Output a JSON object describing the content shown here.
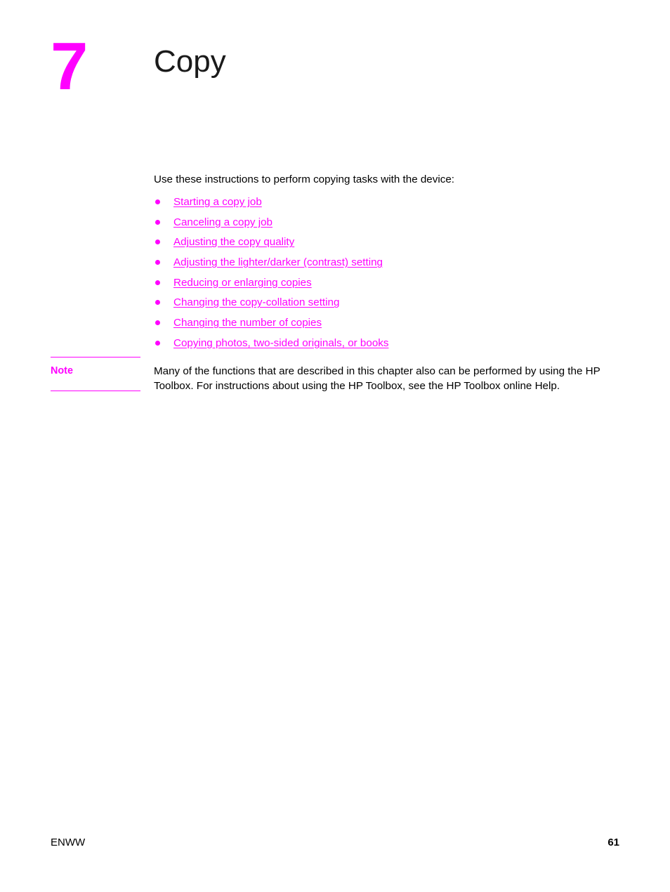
{
  "chapter": {
    "number": "7",
    "title": "Copy",
    "number_color": "#ff00ff",
    "title_color": "#1a1a1a"
  },
  "intro": {
    "text": "Use these instructions to perform copying tasks with the device:"
  },
  "toc": {
    "bullet_color": "#ff00ff",
    "link_color": "#ff00ff",
    "items": [
      {
        "label": "Starting a copy job"
      },
      {
        "label": "Canceling a copy job"
      },
      {
        "label": "Adjusting the copy quality"
      },
      {
        "label": "Adjusting the lighter/darker (contrast) setting"
      },
      {
        "label": "Reducing or enlarging copies"
      },
      {
        "label": "Changing the copy-collation setting"
      },
      {
        "label": "Changing the number of copies"
      },
      {
        "label": "Copying photos, two-sided originals, or books"
      }
    ]
  },
  "note": {
    "label": "Note",
    "label_color": "#ff00ff",
    "rule_color": "#ff00ff",
    "body": "Many of the functions that are described in this chapter also can be performed by using the HP Toolbox. For instructions about using the HP Toolbox, see the HP Toolbox online Help."
  },
  "footer": {
    "left": "ENWW",
    "page_number": "61"
  }
}
